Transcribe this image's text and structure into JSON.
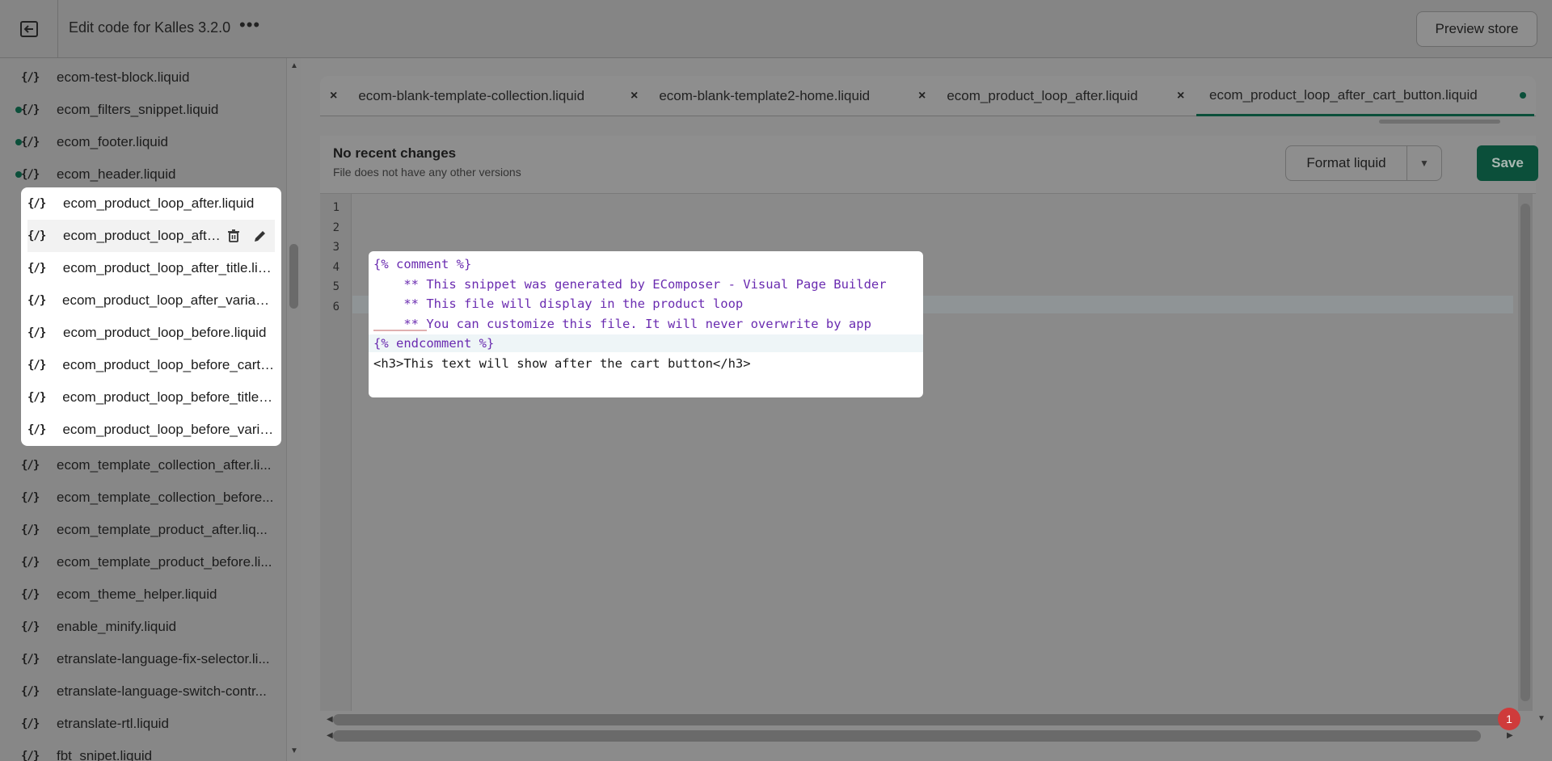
{
  "header": {
    "title": "Edit code for Kalles 3.2.0",
    "more_label": "•••",
    "preview_label": "Preview store"
  },
  "sidebar": {
    "files": [
      {
        "name": "ecom-test-block.liquid",
        "modified": false
      },
      {
        "name": "ecom_filters_snippet.liquid",
        "modified": true
      },
      {
        "name": "ecom_footer.liquid",
        "modified": true
      },
      {
        "name": "ecom_header.liquid",
        "modified": true
      },
      {
        "name": "ecom_product_loop_after.liquid",
        "modified": false
      },
      {
        "name": "ecom_product_loop_afte...",
        "modified": false
      },
      {
        "name": "ecom_product_loop_after_title.liq...",
        "modified": false
      },
      {
        "name": "ecom_product_loop_after_variant....",
        "modified": false
      },
      {
        "name": "ecom_product_loop_before.liquid",
        "modified": false
      },
      {
        "name": "ecom_product_loop_before_cart_...",
        "modified": false
      },
      {
        "name": "ecom_product_loop_before_title.li...",
        "modified": false
      },
      {
        "name": "ecom_product_loop_before_varia...",
        "modified": false
      },
      {
        "name": "ecom_template_collection_after.li...",
        "modified": false
      },
      {
        "name": "ecom_template_collection_before...",
        "modified": false
      },
      {
        "name": "ecom_template_product_after.liq...",
        "modified": false
      },
      {
        "name": "ecom_template_product_before.li...",
        "modified": false
      },
      {
        "name": "ecom_theme_helper.liquid",
        "modified": false
      },
      {
        "name": "enable_minify.liquid",
        "modified": false
      },
      {
        "name": "etranslate-language-fix-selector.li...",
        "modified": false
      },
      {
        "name": "etranslate-language-switch-contr...",
        "modified": false
      },
      {
        "name": "etranslate-rtl.liquid",
        "modified": false
      },
      {
        "name": "fbt_snipet.liquid",
        "modified": false
      }
    ],
    "file_icon": "{/}"
  },
  "tabs": [
    {
      "label": "ecom-blank-template-collection.liquid"
    },
    {
      "label": "ecom-blank-template2-home.liquid"
    },
    {
      "label": "ecom_product_loop_after.liquid"
    },
    {
      "label": "ecom_product_loop_after_cart_button.liquid"
    }
  ],
  "toolbar": {
    "status_title": "No recent changes",
    "status_sub": "File does not have any other versions",
    "format_label": "Format liquid",
    "save_label": "Save"
  },
  "code": {
    "lines": [
      "{% comment %}",
      "    ** This snippet was generated by EComposer - Visual Page Builder",
      "    ** This file will display in the product loop",
      "    ** You can customize this file. It will never overwrite by app",
      "{% endcomment %}",
      "<h3>This text will show after the cart button</h3>"
    ],
    "line_numbers": [
      "1",
      "2",
      "3",
      "4",
      "5",
      "6"
    ]
  },
  "notification_count": "1",
  "colors": {
    "accent": "#0b4f3a",
    "badge": "#cf3b3b"
  }
}
